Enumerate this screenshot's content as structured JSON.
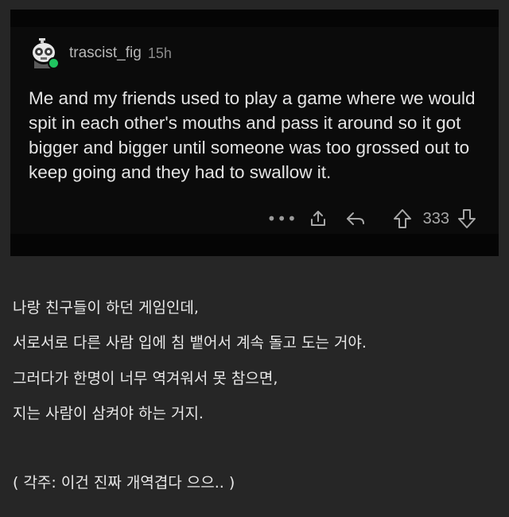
{
  "post": {
    "username": "trascist_fig",
    "time": "15h",
    "body": "Me and my friends used to play a game where we would spit in each other's mouths and pass it around so it got bigger and bigger until someone was too grossed out to keep going and they had to swallow it.",
    "actions": {
      "more_label": "•••",
      "score": "333"
    },
    "icons": [
      "avatar",
      "online-dot",
      "more-icon",
      "share-icon",
      "reply-icon",
      "upvote-icon",
      "downvote-icon"
    ]
  },
  "caption": {
    "lines": [
      "나랑 친구들이 하던 게임인데,",
      "서로서로 다른 사람 입에 침 뱉어서 계속 돌고 도는 거야.",
      "그러다가 한명이 너무 역겨워서 못 참으면,",
      "지는 사람이 삼켜야 하는 거지.",
      "( 각주: 이건 진짜 개역겹다 으으.. )"
    ]
  },
  "colors": {
    "background": "#262626",
    "card": "#0b0b0b",
    "online": "#1fc45f",
    "text": "#e4e4e4",
    "muted": "#9b9b9b"
  }
}
